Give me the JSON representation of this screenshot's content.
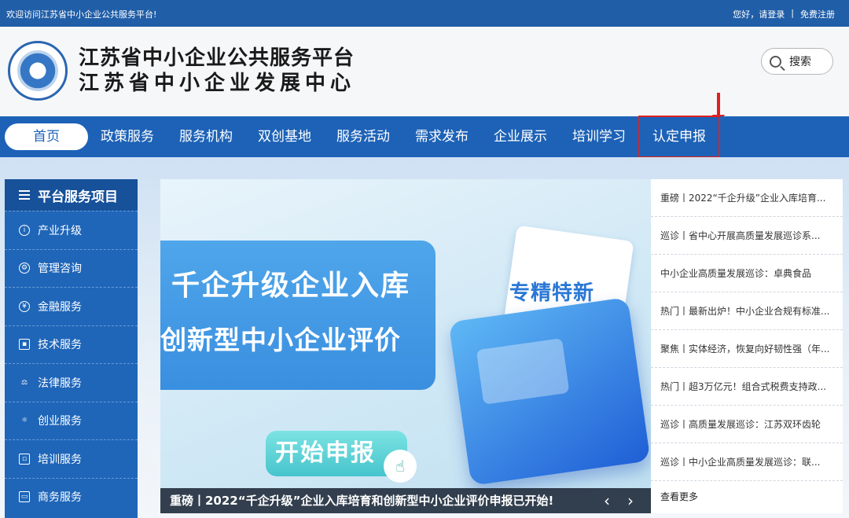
{
  "topbar": {
    "welcome": "欢迎访问江苏省中小企业公共服务平台!",
    "login": "您好，请登录",
    "separator": "|",
    "register": "免费注册"
  },
  "header": {
    "title_line1": "江苏省中小企业公共服务平台",
    "title_line2": "江苏省中小企业发展中心",
    "search_label": "搜索"
  },
  "nav": {
    "items": [
      "首页",
      "政策服务",
      "服务机构",
      "双创基地",
      "服务活动",
      "需求发布",
      "企业展示",
      "培训学习",
      "认定申报"
    ]
  },
  "sidebar": {
    "title": "平台服务项目",
    "items": [
      "产业升级",
      "管理咨询",
      "金融服务",
      "技术服务",
      "法律服务",
      "创业服务",
      "培训服务",
      "商务服务"
    ]
  },
  "banner": {
    "line1": "千企升级企业入库",
    "line2": "创新型中小企业评价",
    "tag": "专精特新",
    "start_button": "开始申报",
    "caption": "重磅丨2022“千企升级”企业入库培育和创新型中小企业评价申报已开始!",
    "prev": "‹",
    "next": "›"
  },
  "news": {
    "items": [
      "重磅丨2022“千企升级”企业入库培育...",
      "巡诊丨省中心开展高质量发展巡诊系...",
      "中小企业高质量发展巡诊：卓典食品",
      "热门丨最新出炉！中小企业合规有标准...",
      "聚焦丨实体经济，恢复向好韧性强（年...",
      "热门丨超3万亿元！组合式税费支持政...",
      "巡诊丨高质量发展巡诊：江苏双环齿轮",
      "巡诊丨中小企业高质量发展巡诊：联..."
    ],
    "more": "查看更多"
  },
  "colors": {
    "primary": "#1d62b7",
    "highlight": "#e02020"
  }
}
